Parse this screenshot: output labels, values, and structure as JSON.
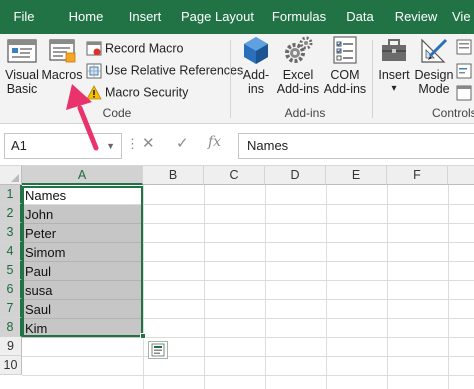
{
  "tabs": [
    "File",
    "Home",
    "Insert",
    "Page Layout",
    "Formulas",
    "Data",
    "Review",
    "Vie"
  ],
  "ribbon": {
    "code_group": {
      "label": "Code",
      "visual_basic": [
        "Visual",
        "Basic"
      ],
      "macros": "Macros",
      "record_macro": "Record Macro",
      "use_relative": "Use Relative References",
      "macro_security": "Macro Security"
    },
    "addins_group": {
      "label": "Add-ins",
      "addins": [
        "Add-",
        "ins"
      ],
      "excel_addins": [
        "Excel",
        "Add-ins"
      ],
      "com_addins": [
        "COM",
        "Add-ins"
      ]
    },
    "controls_group": {
      "label": "Controls",
      "insert": "Insert",
      "insert_dropdown": "▾",
      "design_mode": [
        "Design",
        "Mode"
      ]
    }
  },
  "formula_bar": {
    "name_box": "A1",
    "cancel": "✕",
    "enter": "✓",
    "fx": "fx",
    "value": "Names"
  },
  "grid": {
    "columns": [
      "A",
      "B",
      "C",
      "D",
      "E",
      "F"
    ],
    "rows": [
      "1",
      "2",
      "3",
      "4",
      "5",
      "6",
      "7",
      "8",
      "9",
      "10"
    ],
    "column_a_values": [
      "Names",
      "John",
      "Peter",
      "Simom",
      "Paul",
      "susa",
      "Saul",
      "Kim"
    ]
  },
  "colors": {
    "excel_green": "#217346",
    "annotation_arrow": "#e8336d",
    "selection_fill": "#c6c6c6"
  },
  "icons": [
    "visual-basic-icon",
    "macros-icon",
    "record-macro-icon",
    "relative-references-icon",
    "macro-security-warning-icon",
    "addins-icon",
    "excel-addins-gear-icon",
    "com-addins-icon",
    "insert-controls-toolbox-icon",
    "design-mode-icon",
    "quick-analysis-icon"
  ]
}
